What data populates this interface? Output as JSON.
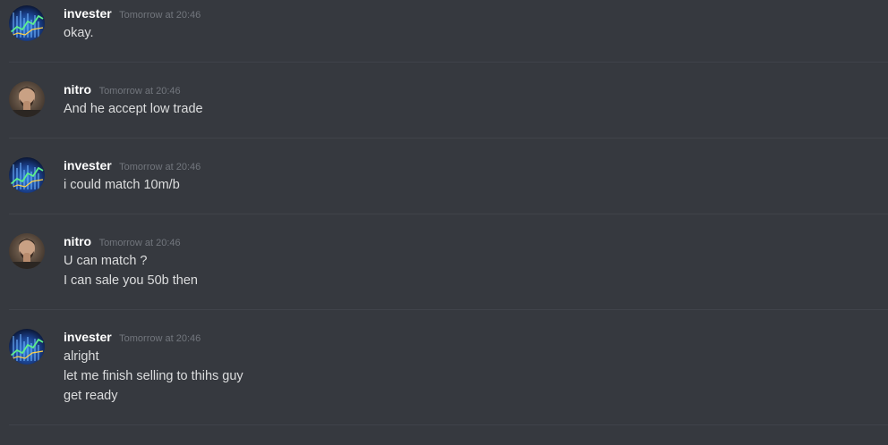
{
  "colors": {
    "background": "#36393f",
    "divider": "#40434a",
    "username": "#ffffff",
    "timestamp": "#72767d",
    "message_text": "#dcddde"
  },
  "messages": [
    {
      "author": "invester",
      "avatar_icon": "stock-chart-avatar-icon",
      "timestamp": "Tomorrow at 20:46",
      "lines": [
        "okay."
      ]
    },
    {
      "author": "nitro",
      "avatar_icon": "user-photo-avatar-icon",
      "timestamp": "Tomorrow at 20:46",
      "lines": [
        "And he accept low trade"
      ]
    },
    {
      "author": "invester",
      "avatar_icon": "stock-chart-avatar-icon",
      "timestamp": "Tomorrow at 20:46",
      "lines": [
        "i could match 10m/b"
      ]
    },
    {
      "author": "nitro",
      "avatar_icon": "user-photo-avatar-icon",
      "timestamp": "Tomorrow at 20:46",
      "lines": [
        "U can match ?",
        "I can sale you 50b then"
      ]
    },
    {
      "author": "invester",
      "avatar_icon": "stock-chart-avatar-icon",
      "timestamp": "Tomorrow at 20:46",
      "lines": [
        "alright",
        "let me finish selling to thihs guy",
        "get ready"
      ]
    }
  ]
}
